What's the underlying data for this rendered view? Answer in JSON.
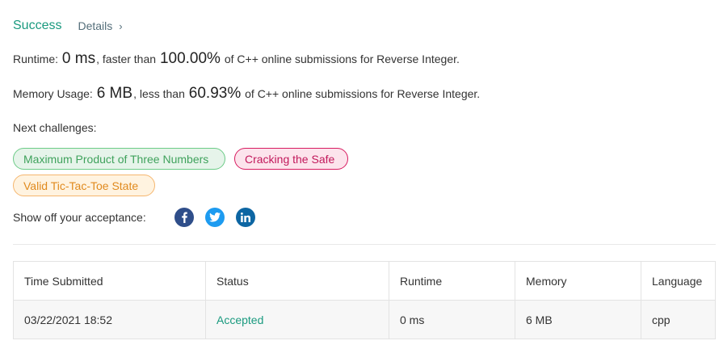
{
  "result": {
    "status": "Success",
    "details_label": "Details",
    "details_chevron": "›"
  },
  "runtime": {
    "label": "Runtime:",
    "value": "0 ms",
    "comparison": ", faster than",
    "percent": "100.00%",
    "suffix": "of C++ online submissions for Reverse Integer."
  },
  "memory": {
    "label": "Memory Usage:",
    "value": "6 MB",
    "comparison": ", less than",
    "percent": "60.93%",
    "suffix": "of C++ online submissions for Reverse Integer."
  },
  "next_challenges": {
    "label": "Next challenges:",
    "items": [
      {
        "label": "Maximum Product of Three Numbers",
        "difficulty_color": "#3fa25c"
      },
      {
        "label": "Cracking the Safe",
        "difficulty_color": "#c2185b"
      },
      {
        "label": "Valid Tic-Tac-Toe State",
        "difficulty_color": "#e08a1e"
      }
    ]
  },
  "share": {
    "label": "Show off your acceptance:",
    "icons": [
      "facebook-icon",
      "twitter-icon",
      "linkedin-icon"
    ]
  },
  "submissions": {
    "columns": [
      "Time Submitted",
      "Status",
      "Runtime",
      "Memory",
      "Language"
    ],
    "rows": [
      {
        "time": "03/22/2021 18:52",
        "status": "Accepted",
        "runtime": "0 ms",
        "memory": "6 MB",
        "language": "cpp"
      }
    ]
  },
  "colors": {
    "accent": "#1a9a7f"
  }
}
